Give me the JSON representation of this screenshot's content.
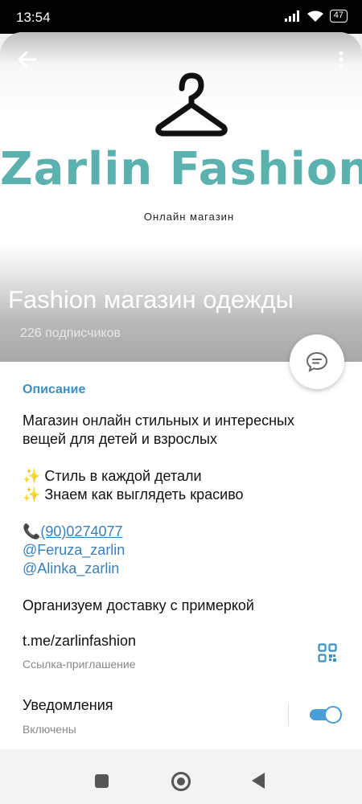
{
  "status_bar": {
    "time": "13:54",
    "battery": "47"
  },
  "header": {
    "brand_name": "Zarlin Fashion",
    "brand_subtitle": "Онлайн магазин",
    "channel_title": "Fashion магазин одежды",
    "subscribers": "226 подписчиков"
  },
  "description": {
    "section_title": "Описание",
    "line1": "Магазин онлайн стильных и интересных",
    "line2": "вещей для детей и взрослых",
    "feature1": "✨ Стиль в каждой детали",
    "feature2": "✨ Знаем как выглядеть красиво",
    "phone_icon": "📞",
    "phone": "(90)0274077",
    "contact1": "@Feruza_zarlin",
    "contact2": "@Alinka_zarlin",
    "delivery": "Организуем доставку с примеркой"
  },
  "invite": {
    "link": "t.me/zarlinfashion",
    "label": "Ссылка-приглашение"
  },
  "notifications": {
    "title": "Уведомления",
    "status": "Включены",
    "enabled": true
  },
  "colors": {
    "accent": "#3a8fc4",
    "brand": "#5ab1ad",
    "toggle": "#4a9ed8"
  }
}
